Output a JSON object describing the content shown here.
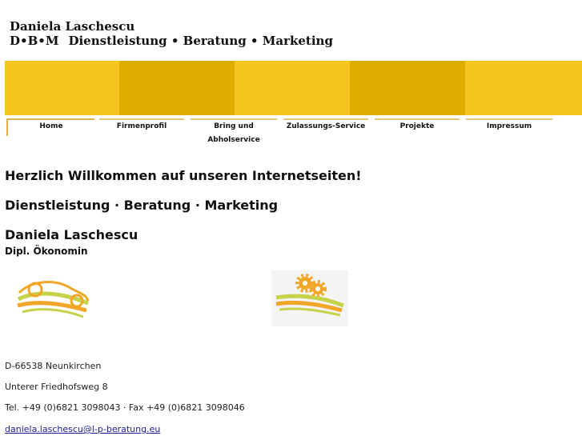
{
  "header": {
    "name": "Daniela Laschescu",
    "brand": "D•B•M",
    "tagline": "Dienstleistung • Beratung • Marketing"
  },
  "banner": {
    "colors": [
      "#f7c51f",
      "#dfad00",
      "#f7c51f",
      "#dfad00",
      "#f7c51f"
    ]
  },
  "nav": {
    "items": [
      "Home",
      "Firmenprofil",
      "Bring und Abholservice",
      "Zulassungs-Service",
      "Projekte",
      "Impressum"
    ],
    "active": "Home"
  },
  "main": {
    "welcome": "Herzlich Willkommen auf unseren Internetseiten!",
    "services": "Dienstleistung · Beratung · Marketing",
    "person": "Daniela Laschescu",
    "title": "Dipl. Ökonomin"
  },
  "logos": {
    "left": "car-logo-icon",
    "right": "gears-logo-icon"
  },
  "contact": {
    "city": "D-66538 Neunkirchen",
    "street": "Unterer Friedhofsweg 8",
    "phone": "Tel. +49 (0)6821 3098043 · Fax +49 (0)6821 3098046",
    "email": "daniela.laschescu@l-p-beratung.eu"
  }
}
